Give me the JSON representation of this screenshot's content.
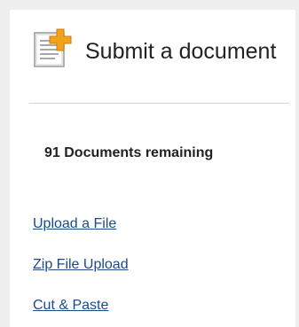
{
  "panel": {
    "title": "Submit a document",
    "icon": "document-add-icon",
    "remaining_text": "91 Documents remaining"
  },
  "links": [
    {
      "label": "Upload a File"
    },
    {
      "label": "Zip File Upload"
    },
    {
      "label": "Cut & Paste"
    }
  ],
  "colors": {
    "link": "#1a4a8a",
    "text": "#222222",
    "icon_plus": "#f2a21a",
    "frame": "#eeeeee"
  }
}
